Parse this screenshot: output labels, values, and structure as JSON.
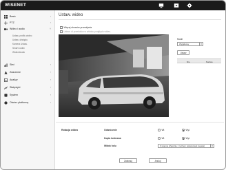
{
  "header": {
    "logo": "WISENET",
    "icons": [
      "monitor-icon",
      "play-icon",
      "gear-icon"
    ]
  },
  "sidebar": {
    "items": [
      {
        "label": "Basic",
        "icon": "grid-icon"
      },
      {
        "label": "PTZ",
        "icon": "ptz-icon"
      },
      {
        "label": "Wideo i audio",
        "icon": "video-icon"
      },
      {
        "label": "Sieć",
        "icon": "network-icon"
      },
      {
        "label": "Zdarzenie",
        "icon": "event-icon"
      },
      {
        "label": "Analizy",
        "icon": "analytics-icon"
      },
      {
        "label": "Statystyki",
        "icon": "chart-icon"
      },
      {
        "label": "System",
        "icon": "system-icon"
      },
      {
        "label": "Otwórz platformę",
        "icon": "platform-icon"
      }
    ],
    "subitems": [
      "Ustaw. profilu wideo",
      "Ustaw. dźwięku",
      "Kamera Ustaw.",
      "Smart codec",
      "Wideo/Audio"
    ]
  },
  "main": {
    "title": "Ustaw. wideo",
    "checkbox1": "Więcej obrazów przewijania",
    "checkbox2": "Ustaw. di przełożów w widoku podglądu wideo.",
    "mode_label": "Mode",
    "mode_value": "Wyjątkowy",
    "apply_button": "Ustaw",
    "table_headers": [
      "Nie",
      "Nazwa"
    ]
  },
  "rotation": {
    "section_title": "Rotacja wideo",
    "flip_label": "Odwrócenie",
    "mirror_label": "Kopia lustrzana",
    "hallway_label": "Widok holu",
    "on": "Wł.",
    "off": "Wył.",
    "flip_value": "off",
    "mirror_value": "off",
    "hallway_value": "0 stopnie (Zgodnie z ruchem wskazówek zegara)"
  },
  "footer": {
    "apply": "Zastosuj",
    "cancel": "Anuluj"
  }
}
